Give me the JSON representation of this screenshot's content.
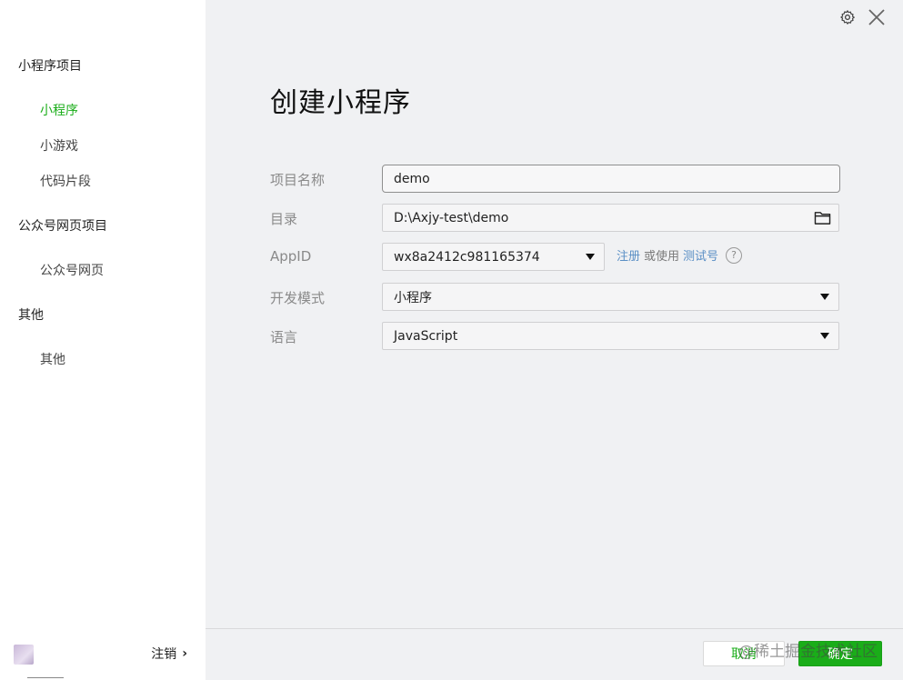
{
  "sidebar": {
    "groups": [
      {
        "title": "小程序项目",
        "items": [
          "小程序",
          "小游戏",
          "代码片段"
        ]
      },
      {
        "title": "公众号网页项目",
        "items": [
          "公众号网页"
        ]
      },
      {
        "title": "其他",
        "items": [
          "其他"
        ]
      }
    ],
    "active_item": "小程序",
    "logout_label": "注销",
    "logout_chevron": "›"
  },
  "header": {
    "settings_icon": "gear-icon",
    "close_icon": "close-icon"
  },
  "main": {
    "title": "创建小程序",
    "fields": {
      "project_name": {
        "label": "项目名称",
        "value": "demo"
      },
      "directory": {
        "label": "目录",
        "value": "D:\\Axjy-test\\demo"
      },
      "appid": {
        "label": "AppID",
        "value": "wx8a2412c981165374"
      },
      "dev_mode": {
        "label": "开发模式",
        "value": "小程序"
      },
      "language": {
        "label": "语言",
        "value": "JavaScript"
      }
    },
    "appid_links": {
      "register": "注册",
      "or_use": "或使用",
      "test_account": "测试号",
      "help": "?"
    }
  },
  "footer": {
    "cancel_label": "取消",
    "ok_label": "确定",
    "watermark": "@稀土掘金技术社区"
  },
  "colors": {
    "accent": "#1aad19",
    "link": "#5a8fc5",
    "background": "#f0f1f3"
  }
}
